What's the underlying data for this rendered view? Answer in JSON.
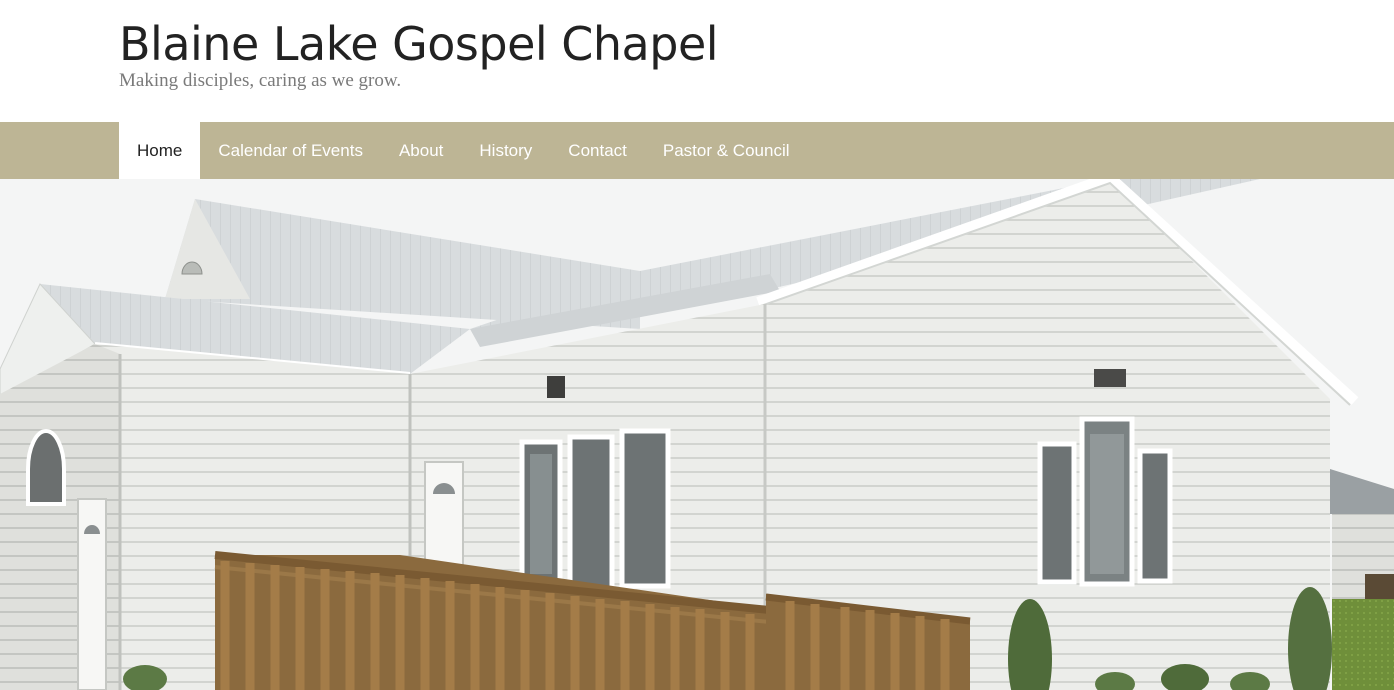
{
  "site": {
    "title": "Blaine Lake Gospel Chapel",
    "tagline": "Making disciples, caring as we grow."
  },
  "nav": {
    "items": [
      {
        "label": "Home",
        "active": true
      },
      {
        "label": "Calendar of Events",
        "active": false
      },
      {
        "label": "About",
        "active": false
      },
      {
        "label": "History",
        "active": false
      },
      {
        "label": "Contact",
        "active": false
      },
      {
        "label": "Pastor & Council",
        "active": false
      }
    ]
  },
  "colors": {
    "nav_background": "#bdb595",
    "nav_text": "#ffffff",
    "active_tab_background": "#ffffff",
    "title_text": "#222222",
    "tagline_text": "#7a7a7a"
  },
  "hero": {
    "subject": "church-building-photo"
  }
}
